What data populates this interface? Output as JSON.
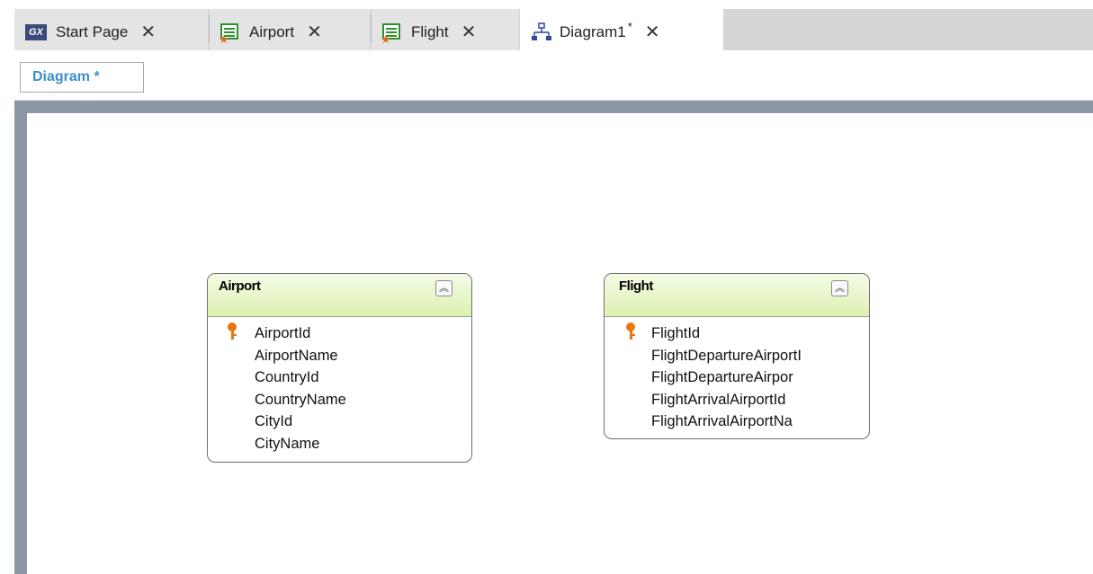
{
  "tabs": [
    {
      "label": "Start Page",
      "icon": "gx-logo-icon",
      "active": false
    },
    {
      "label": "Airport",
      "icon": "transaction-icon",
      "active": false
    },
    {
      "label": "Flight",
      "icon": "transaction-icon",
      "active": false
    },
    {
      "label": "Diagram1",
      "modified_marker": "*",
      "icon": "diagram-icon",
      "active": true
    }
  ],
  "close_glyph": "✕",
  "toolbar": {
    "diagram_label": "Diagram *"
  },
  "gx_logo_text": "GX",
  "collapse_glyph": "︽",
  "entities": [
    {
      "title": "Airport",
      "attributes": [
        "AirportId",
        "AirportName",
        "CountryId",
        "CountryName",
        "CityId",
        "CityName"
      ],
      "key_attribute": "AirportId"
    },
    {
      "title": "Flight",
      "attributes": [
        "FlightId",
        "FlightDepartureAirportI",
        "FlightDepartureAirpor",
        "FlightArrivalAirportId",
        "FlightArrivalAirportNa"
      ],
      "key_attribute": "FlightId"
    }
  ],
  "colors": {
    "accent_blue": "#3a8fc7",
    "entity_header": "#dcf2b0",
    "key_icon": "#e8760e",
    "canvas_border": "#8d96a4"
  }
}
